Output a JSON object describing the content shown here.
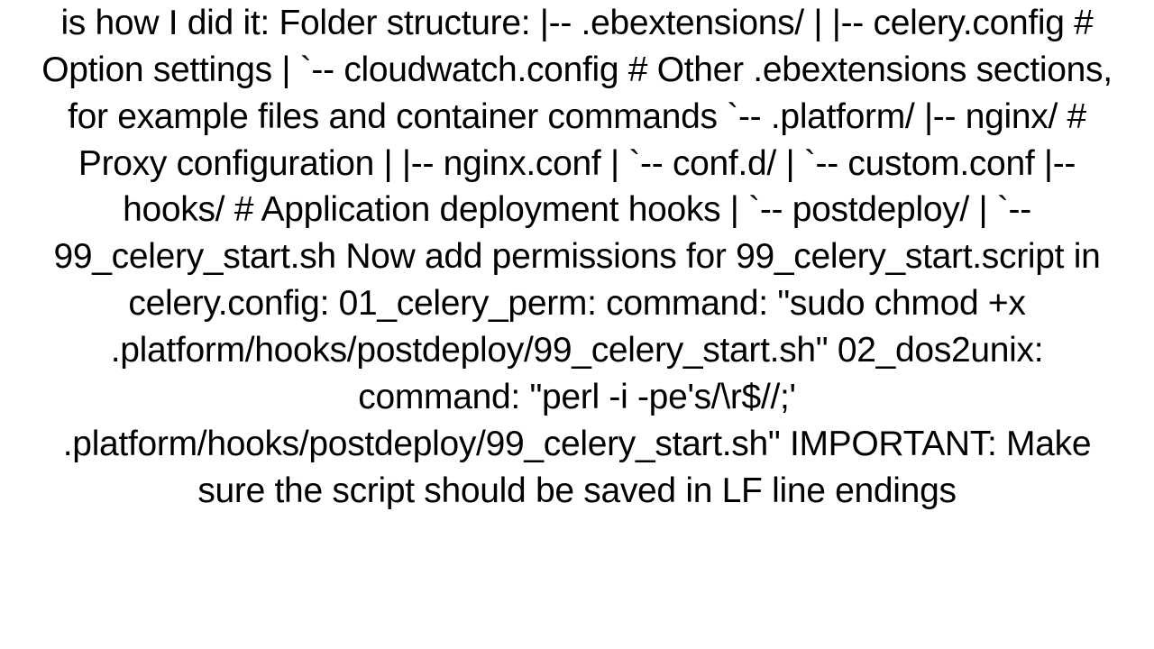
{
  "text": "is how I did it: Folder structure: |-- .ebextensions/ |   |-- celery.config        # Option settings |   `-- cloudwatch.config     # Other .ebextensions sections, for example files and container commands `-- .platform/     |-- nginx/                # Proxy configuration     |   |-- nginx.conf     |   `-- conf.d/     |       `-- custom.conf     |-- hooks/                # Application deployment hooks     |   `-- postdeploy/     |       `-- 99_celery_start.sh  Now add permissions for 99_celery_start.script in celery.config:   01_celery_perm:     command: \"sudo chmod +x .platform/hooks/postdeploy/99_celery_start.sh\" 02_dos2unix:     command: \"perl -i -pe's/\\r$//;' .platform/hooks/postdeploy/99_celery_start.sh\"  IMPORTANT: Make sure the script should be saved in LF line endings"
}
